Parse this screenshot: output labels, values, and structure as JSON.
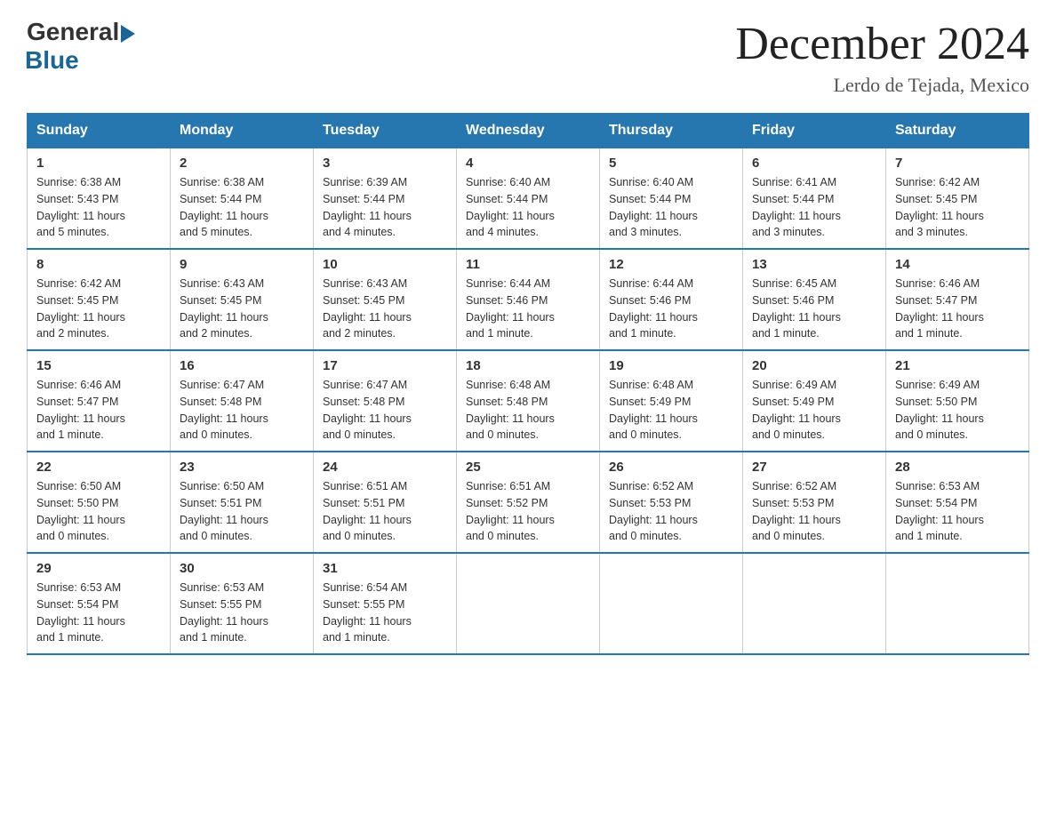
{
  "header": {
    "logo_general": "General",
    "logo_blue": "Blue",
    "title": "December 2024",
    "subtitle": "Lerdo de Tejada, Mexico"
  },
  "days_of_week": [
    "Sunday",
    "Monday",
    "Tuesday",
    "Wednesday",
    "Thursday",
    "Friday",
    "Saturday"
  ],
  "weeks": [
    [
      {
        "day": "1",
        "sunrise": "6:38 AM",
        "sunset": "5:43 PM",
        "daylight": "11 hours and 5 minutes."
      },
      {
        "day": "2",
        "sunrise": "6:38 AM",
        "sunset": "5:44 PM",
        "daylight": "11 hours and 5 minutes."
      },
      {
        "day": "3",
        "sunrise": "6:39 AM",
        "sunset": "5:44 PM",
        "daylight": "11 hours and 4 minutes."
      },
      {
        "day": "4",
        "sunrise": "6:40 AM",
        "sunset": "5:44 PM",
        "daylight": "11 hours and 4 minutes."
      },
      {
        "day": "5",
        "sunrise": "6:40 AM",
        "sunset": "5:44 PM",
        "daylight": "11 hours and 3 minutes."
      },
      {
        "day": "6",
        "sunrise": "6:41 AM",
        "sunset": "5:44 PM",
        "daylight": "11 hours and 3 minutes."
      },
      {
        "day": "7",
        "sunrise": "6:42 AM",
        "sunset": "5:45 PM",
        "daylight": "11 hours and 3 minutes."
      }
    ],
    [
      {
        "day": "8",
        "sunrise": "6:42 AM",
        "sunset": "5:45 PM",
        "daylight": "11 hours and 2 minutes."
      },
      {
        "day": "9",
        "sunrise": "6:43 AM",
        "sunset": "5:45 PM",
        "daylight": "11 hours and 2 minutes."
      },
      {
        "day": "10",
        "sunrise": "6:43 AM",
        "sunset": "5:45 PM",
        "daylight": "11 hours and 2 minutes."
      },
      {
        "day": "11",
        "sunrise": "6:44 AM",
        "sunset": "5:46 PM",
        "daylight": "11 hours and 1 minute."
      },
      {
        "day": "12",
        "sunrise": "6:44 AM",
        "sunset": "5:46 PM",
        "daylight": "11 hours and 1 minute."
      },
      {
        "day": "13",
        "sunrise": "6:45 AM",
        "sunset": "5:46 PM",
        "daylight": "11 hours and 1 minute."
      },
      {
        "day": "14",
        "sunrise": "6:46 AM",
        "sunset": "5:47 PM",
        "daylight": "11 hours and 1 minute."
      }
    ],
    [
      {
        "day": "15",
        "sunrise": "6:46 AM",
        "sunset": "5:47 PM",
        "daylight": "11 hours and 1 minute."
      },
      {
        "day": "16",
        "sunrise": "6:47 AM",
        "sunset": "5:48 PM",
        "daylight": "11 hours and 0 minutes."
      },
      {
        "day": "17",
        "sunrise": "6:47 AM",
        "sunset": "5:48 PM",
        "daylight": "11 hours and 0 minutes."
      },
      {
        "day": "18",
        "sunrise": "6:48 AM",
        "sunset": "5:48 PM",
        "daylight": "11 hours and 0 minutes."
      },
      {
        "day": "19",
        "sunrise": "6:48 AM",
        "sunset": "5:49 PM",
        "daylight": "11 hours and 0 minutes."
      },
      {
        "day": "20",
        "sunrise": "6:49 AM",
        "sunset": "5:49 PM",
        "daylight": "11 hours and 0 minutes."
      },
      {
        "day": "21",
        "sunrise": "6:49 AM",
        "sunset": "5:50 PM",
        "daylight": "11 hours and 0 minutes."
      }
    ],
    [
      {
        "day": "22",
        "sunrise": "6:50 AM",
        "sunset": "5:50 PM",
        "daylight": "11 hours and 0 minutes."
      },
      {
        "day": "23",
        "sunrise": "6:50 AM",
        "sunset": "5:51 PM",
        "daylight": "11 hours and 0 minutes."
      },
      {
        "day": "24",
        "sunrise": "6:51 AM",
        "sunset": "5:51 PM",
        "daylight": "11 hours and 0 minutes."
      },
      {
        "day": "25",
        "sunrise": "6:51 AM",
        "sunset": "5:52 PM",
        "daylight": "11 hours and 0 minutes."
      },
      {
        "day": "26",
        "sunrise": "6:52 AM",
        "sunset": "5:53 PM",
        "daylight": "11 hours and 0 minutes."
      },
      {
        "day": "27",
        "sunrise": "6:52 AM",
        "sunset": "5:53 PM",
        "daylight": "11 hours and 0 minutes."
      },
      {
        "day": "28",
        "sunrise": "6:53 AM",
        "sunset": "5:54 PM",
        "daylight": "11 hours and 1 minute."
      }
    ],
    [
      {
        "day": "29",
        "sunrise": "6:53 AM",
        "sunset": "5:54 PM",
        "daylight": "11 hours and 1 minute."
      },
      {
        "day": "30",
        "sunrise": "6:53 AM",
        "sunset": "5:55 PM",
        "daylight": "11 hours and 1 minute."
      },
      {
        "day": "31",
        "sunrise": "6:54 AM",
        "sunset": "5:55 PM",
        "daylight": "11 hours and 1 minute."
      },
      null,
      null,
      null,
      null
    ]
  ],
  "labels": {
    "sunrise": "Sunrise:",
    "sunset": "Sunset:",
    "daylight": "Daylight:"
  }
}
